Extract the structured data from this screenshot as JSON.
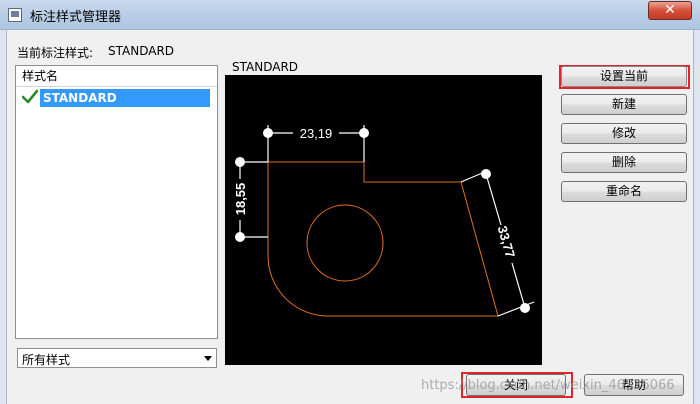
{
  "window": {
    "title": "标注样式管理器",
    "close_symbol": "✕"
  },
  "current_style": {
    "label": "当前标注样式:",
    "value": "STANDARD"
  },
  "style_list": {
    "header": "样式名",
    "items": [
      {
        "label": "STANDARD",
        "selected": true,
        "is_current": true
      }
    ]
  },
  "preview": {
    "label": "STANDARD",
    "dimensions": {
      "horizontal": "23,19",
      "vertical": "18,55",
      "aligned": "33,77"
    },
    "colors": {
      "background": "#000000",
      "geometry": "#e07020",
      "dimension": "#ffffff"
    }
  },
  "buttons": {
    "set_current": "设置当前",
    "new": "新建",
    "modify": "修改",
    "delete": "删除",
    "rename": "重命名",
    "close": "关闭",
    "help": "帮助"
  },
  "list_filter": {
    "selected": "所有样式"
  },
  "watermark": "https://blog.csdn.net/weixin_46336066",
  "highlight_color": "#e0242a"
}
